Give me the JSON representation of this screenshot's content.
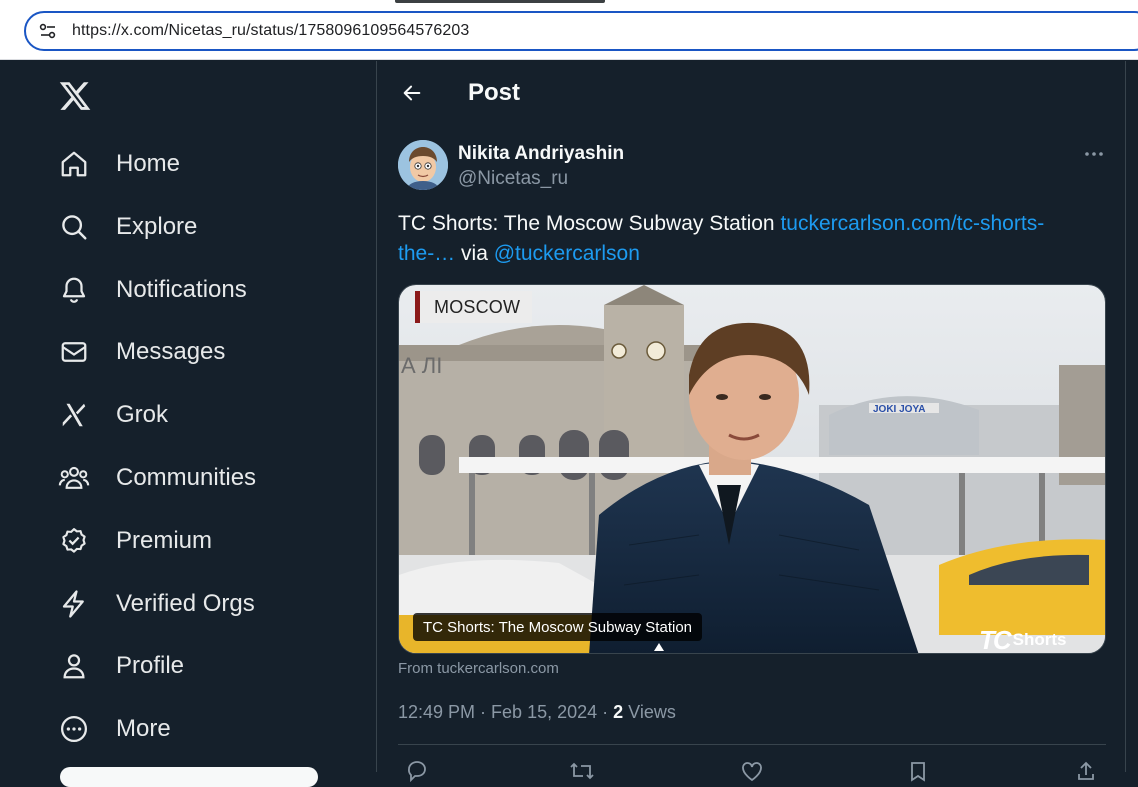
{
  "browser": {
    "url": "https://x.com/Nicetas_ru/status/1758096109564576203",
    "site_info_icon": "tune-icon"
  },
  "sidebar": {
    "logo": "x-logo",
    "items": [
      {
        "label": "Home",
        "icon": "home-icon"
      },
      {
        "label": "Explore",
        "icon": "search-icon"
      },
      {
        "label": "Notifications",
        "icon": "bell-icon"
      },
      {
        "label": "Messages",
        "icon": "envelope-icon"
      },
      {
        "label": "Grok",
        "icon": "grok-icon"
      },
      {
        "label": "Communities",
        "icon": "people-icon"
      },
      {
        "label": "Premium",
        "icon": "verified-badge-icon"
      },
      {
        "label": "Verified Orgs",
        "icon": "lightning-icon"
      },
      {
        "label": "Profile",
        "icon": "person-icon"
      },
      {
        "label": "More",
        "icon": "more-circle-icon"
      }
    ]
  },
  "header": {
    "title": "Post",
    "back_icon": "arrow-left-icon"
  },
  "post": {
    "author_name": "Nikita Andriyashin",
    "author_handle": "@Nicetas_ru",
    "text_prefix": "TC Shorts: The Moscow Subway Station ",
    "link_text": "tuckercarlson.com/tc-shorts-the-…",
    "text_via": " via ",
    "mention": "@tuckercarlson",
    "card": {
      "location_tag": "MOSCOW",
      "caption": "TC Shorts: The Moscow Subway Station",
      "logo_tc": "TC",
      "logo_shorts": "Shorts",
      "signage": "JOKI JOYA",
      "signage2": "А ЛІ"
    },
    "card_source": "From tuckercarlson.com",
    "time": "12:49 PM",
    "separator": " · ",
    "date": "Feb 15, 2024",
    "views_count": "2",
    "views_label": " Views"
  },
  "colors": {
    "background": "#15202b",
    "border": "#38444d",
    "link": "#1d9bf0",
    "secondary_text": "#8b98a5",
    "primary_text": "#f7f9f9"
  }
}
